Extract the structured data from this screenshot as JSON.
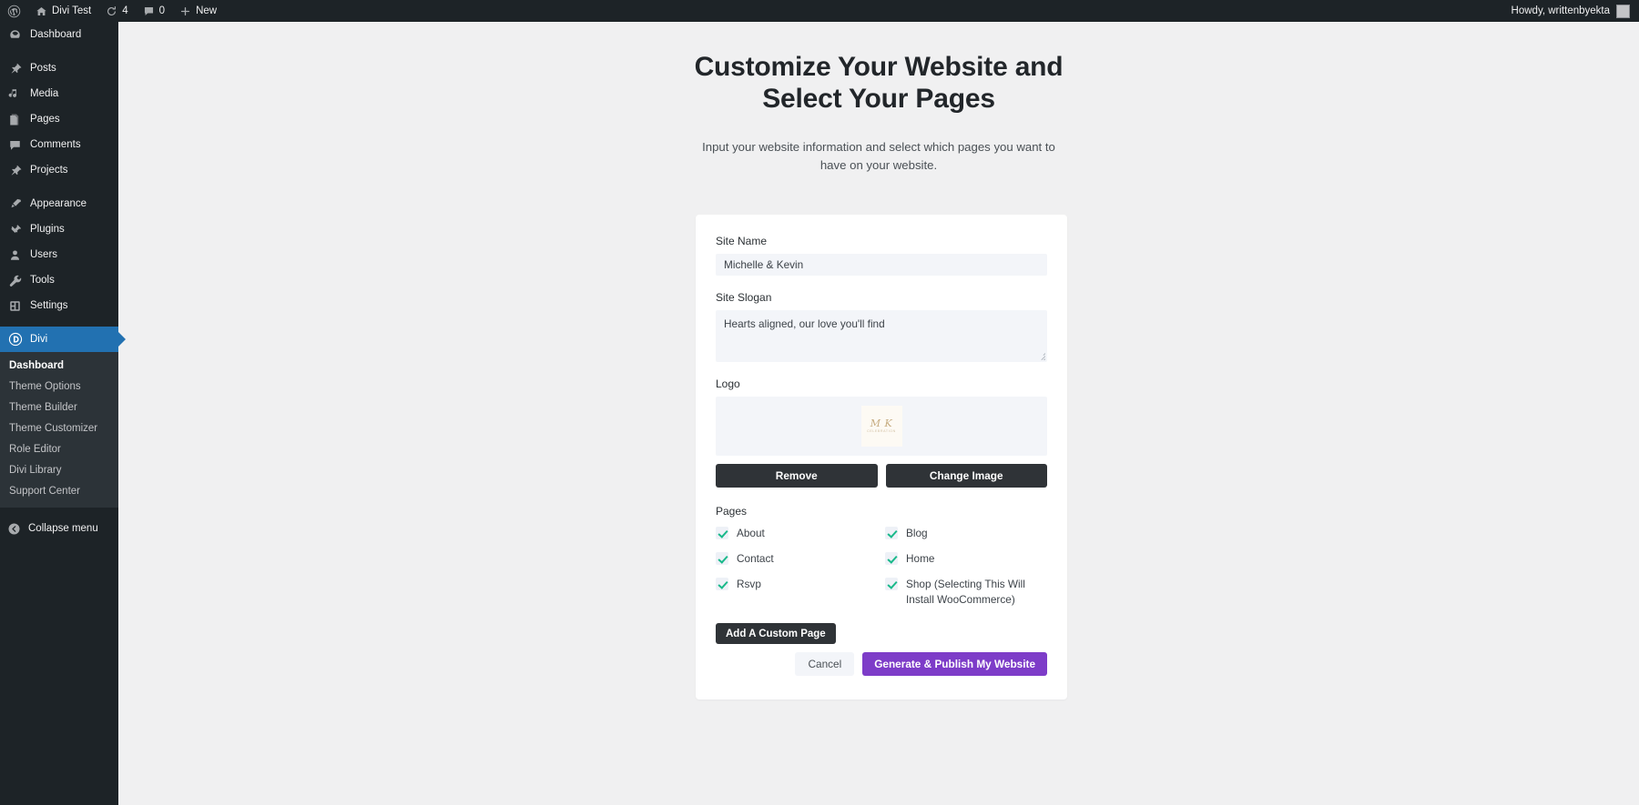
{
  "adminbar": {
    "wp_logo_name": "wordpress-logo-icon",
    "site": {
      "icon": "home-icon",
      "label": "Divi Test"
    },
    "updates": {
      "icon": "update-icon",
      "count": "4"
    },
    "comments": {
      "icon": "comment-icon",
      "count": "0"
    },
    "new": {
      "icon": "plus-icon",
      "label": "New"
    },
    "howdy": "Howdy, writtenbyekta"
  },
  "sidebar": {
    "items": [
      {
        "label": "Dashboard",
        "icon": "dashboard-icon"
      },
      {
        "label": "Posts",
        "icon": "pin-icon"
      },
      {
        "label": "Media",
        "icon": "media-icon"
      },
      {
        "label": "Pages",
        "icon": "pages-icon"
      },
      {
        "label": "Comments",
        "icon": "comment-icon"
      },
      {
        "label": "Projects",
        "icon": "pin-icon"
      },
      {
        "label": "Appearance",
        "icon": "brush-icon"
      },
      {
        "label": "Plugins",
        "icon": "plugin-icon"
      },
      {
        "label": "Users",
        "icon": "user-icon"
      },
      {
        "label": "Tools",
        "icon": "wrench-icon"
      },
      {
        "label": "Settings",
        "icon": "settings-icon"
      },
      {
        "label": "Divi",
        "icon": "divi-logo-icon"
      }
    ],
    "divi_submenu": [
      "Dashboard",
      "Theme Options",
      "Theme Builder",
      "Theme Customizer",
      "Role Editor",
      "Divi Library",
      "Support Center"
    ],
    "collapse": {
      "label": "Collapse menu",
      "icon": "collapse-arrow-icon"
    },
    "active_item": "Divi",
    "active_submenu": "Dashboard",
    "active_color": "#2271b1"
  },
  "page": {
    "heading_line1": "Customize Your Website and",
    "heading_line2": "Select Your Pages",
    "subtitle": "Input your website information and select which pages you want to have on your website."
  },
  "form": {
    "site_name": {
      "label": "Site Name",
      "value": "Michelle & Kevin",
      "placeholder": "Site Name"
    },
    "site_slogan": {
      "label": "Site Slogan",
      "value": "Hearts aligned, our love you'll find",
      "placeholder": "Site Slogan"
    },
    "logo": {
      "label": "Logo",
      "monogram": "M K",
      "monogram_sub": "CELEBRATION",
      "remove_label": "Remove",
      "change_label": "Change Image"
    },
    "pages": {
      "label": "Pages",
      "items": [
        {
          "label": "About",
          "checked": true
        },
        {
          "label": "Blog",
          "checked": true
        },
        {
          "label": "Contact",
          "checked": true
        },
        {
          "label": "Home",
          "checked": true
        },
        {
          "label": "Rsvp",
          "checked": true
        },
        {
          "label": "Shop (Selecting This Will Install WooCommerce)",
          "checked": true
        }
      ],
      "add_custom_label": "Add A Custom Page"
    },
    "cancel_label": "Cancel",
    "submit_label": "Generate & Publish My Website",
    "submit_color": "#7d3cc8",
    "check_color": "#19b98a"
  }
}
